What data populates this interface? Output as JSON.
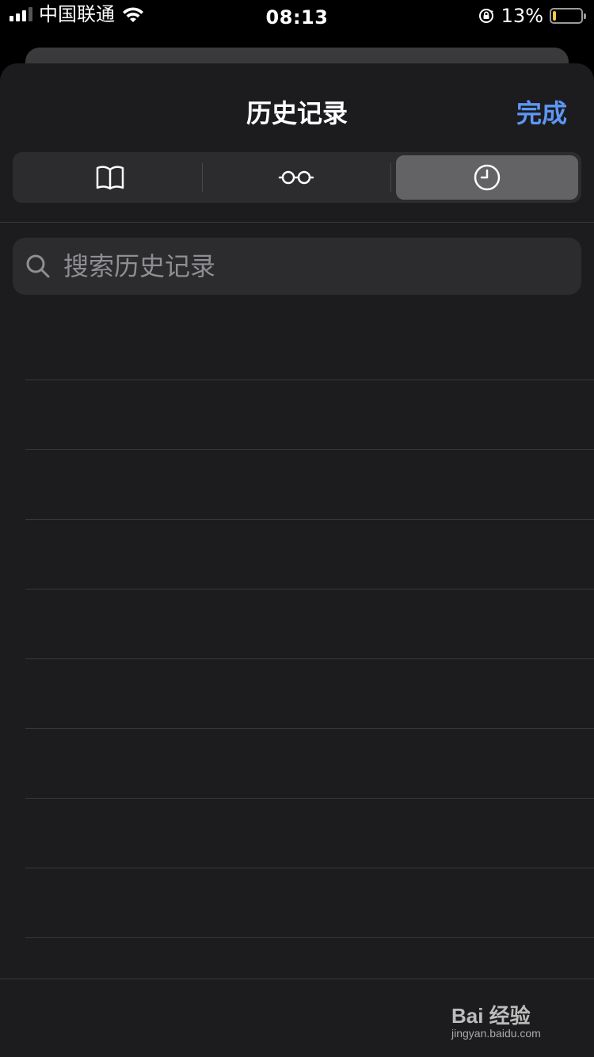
{
  "status_bar": {
    "carrier": "中国联通",
    "time": "08:13",
    "battery_percent": "13%",
    "battery_level": 0.13
  },
  "history_sheet": {
    "title": "历史记录",
    "done_label": "完成",
    "segments": {
      "bookmarks_icon": "book-icon",
      "reading_list_icon": "glasses-icon",
      "history_icon": "clock-icon",
      "selected": "history"
    },
    "search": {
      "placeholder": "搜索历史记录",
      "value": ""
    },
    "empty_rows": 8
  },
  "watermark": {
    "brand": "Bai 经验",
    "url": "jingyan.baidu.com"
  },
  "colors": {
    "accent": "#5d97f3",
    "sheet_bg": "#1c1c1e",
    "control_bg": "#2c2c2e",
    "selected_segment": "#636366"
  }
}
